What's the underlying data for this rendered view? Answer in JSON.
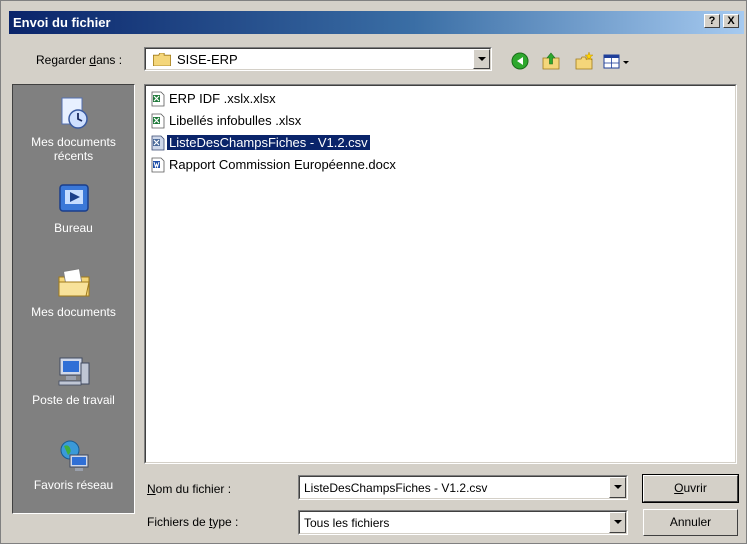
{
  "window": {
    "title": "Envoi du fichier",
    "help_label": "?",
    "close_label": "X"
  },
  "lookin": {
    "label_prefix": "Regarder ",
    "label_accel": "d",
    "label_suffix": "ans :",
    "value": "SISE-ERP"
  },
  "toolbar": {
    "icons": [
      "back-icon",
      "up-folder-icon",
      "new-folder-icon",
      "view-menu-icon"
    ]
  },
  "places": [
    {
      "label": "Mes documents récents",
      "icon": "recent-documents-icon"
    },
    {
      "label": "Bureau",
      "icon": "desktop-icon"
    },
    {
      "label": "Mes documents",
      "icon": "my-documents-icon"
    },
    {
      "label": "Poste de travail",
      "icon": "my-computer-icon"
    },
    {
      "label": "Favoris réseau",
      "icon": "network-places-icon"
    }
  ],
  "files": [
    {
      "name": "ERP IDF .xslx.xlsx",
      "type": "excel",
      "selected": false
    },
    {
      "name": "Libellés infobulles .xlsx",
      "type": "excel",
      "selected": false
    },
    {
      "name": "ListeDesChampsFiches - V1.2.csv",
      "type": "csv",
      "selected": true
    },
    {
      "name": "Rapport Commission Européenne.docx",
      "type": "word",
      "selected": false
    }
  ],
  "filename": {
    "label_accel": "N",
    "label_rest": "om du fichier :",
    "value": "ListeDesChampsFiches - V1.2.csv"
  },
  "filetype": {
    "label_prefix": "Fichiers de ",
    "label_accel": "t",
    "label_suffix": "ype :",
    "value": "Tous les fichiers"
  },
  "buttons": {
    "open_accel": "O",
    "open_rest": "uvrir",
    "cancel": "Annuler"
  },
  "colors": {
    "title_start": "#0a246a",
    "title_end": "#a6caf0",
    "face": "#d4d0c8",
    "places_bg": "#808080",
    "selection": "#0a246a"
  }
}
